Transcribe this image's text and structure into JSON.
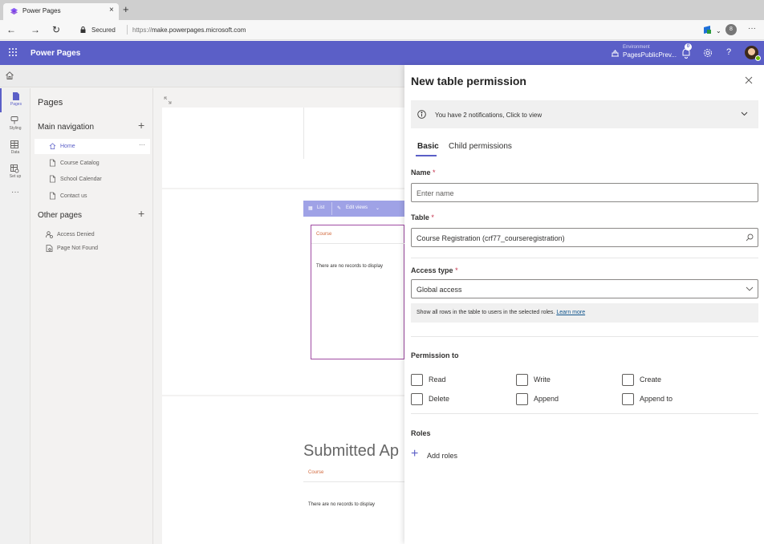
{
  "browser": {
    "tab_title": "Power Pages",
    "tab_close": "×",
    "new_tab": "+",
    "security_label": "Secured",
    "url_protocol": "https://",
    "url_host": "make.powerpages.microsoft.com",
    "profile_initial": "8",
    "more": "···"
  },
  "appbar": {
    "app_name": "Power Pages",
    "env_label": "Environment",
    "env_name": "PagesPublicPrev...",
    "notification_count": "0",
    "help": "?"
  },
  "rail": {
    "items": [
      {
        "label": "Pages",
        "icon": "page-icon"
      },
      {
        "label": "Styling",
        "icon": "styling-icon"
      },
      {
        "label": "Data",
        "icon": "table-icon"
      },
      {
        "label": "Set up",
        "icon": "setup-icon"
      },
      {
        "label": "···",
        "icon": "more-icon"
      }
    ]
  },
  "pages_nav": {
    "header": "Pages",
    "main_nav_label": "Main navigation",
    "main_nav_add": "+",
    "items": [
      {
        "label": "Home",
        "icon": "home-icon"
      },
      {
        "label": "Course Catalog",
        "icon": "page-icon"
      },
      {
        "label": "School Calendar",
        "icon": "page-icon"
      },
      {
        "label": "Contact us",
        "icon": "page-icon"
      }
    ],
    "item_more": "···",
    "other_pages_label": "Other pages",
    "other_pages_add": "+",
    "other_items": [
      {
        "label": "Access Denied",
        "icon": "access-denied-icon"
      },
      {
        "label": "Page Not Found",
        "icon": "page-not-found-icon"
      }
    ]
  },
  "canvas": {
    "list_button": "List",
    "edit_views_button": "Edit views",
    "list_column": "Course",
    "no_records": "There are no records to display",
    "submitted_heading": "Submitted Ap",
    "list_column_2": "Course",
    "no_records_2": "There are no records to display"
  },
  "panel": {
    "title": "New table permission",
    "notification_text": "You have 2 notifications, Click to view",
    "tabs": [
      "Basic",
      "Child permissions"
    ],
    "name_label": "Name",
    "name_placeholder": "Enter name",
    "table_label": "Table",
    "table_value": "Course Registration (crf77_courseregistration)",
    "access_type_label": "Access type",
    "access_type_value": "Global access",
    "access_hint": "Show all rows in the table to users in the selected roles.",
    "learn_more": "Learn more",
    "required_mark": "*",
    "permission_label": "Permission to",
    "permissions": [
      "Read",
      "Write",
      "Create",
      "Delete",
      "Append",
      "Append to"
    ],
    "roles_label": "Roles",
    "add_roles": "Add roles"
  },
  "colors": {
    "accent": "#5b5fc7",
    "list_toolbar": "#9fa2e6",
    "list_border": "#a04ba3",
    "column_header": "#d2693d"
  }
}
